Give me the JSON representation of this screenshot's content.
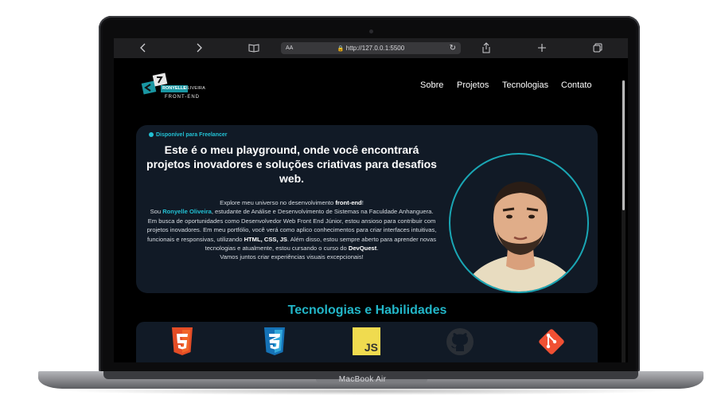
{
  "device": {
    "label": "MacBook Air"
  },
  "browser": {
    "url": "http://127.0.0.1:5500",
    "reader_label": "AA",
    "back_icon": "chevron-left-icon",
    "forward_icon": "chevron-right-icon",
    "bookmarks_icon": "book-icon",
    "share_icon": "share-icon",
    "new_tab_icon": "plus-icon",
    "tabs_icon": "tabs-icon"
  },
  "header": {
    "logo": {
      "first_name": "RONYELLE",
      "last_name": "OLIVEIRA",
      "subtitle": "FRONT-END"
    },
    "nav": [
      "Sobre",
      "Projetos",
      "Tecnologias",
      "Contato"
    ]
  },
  "hero": {
    "badge": "Disponível para Freelancer",
    "headline": "Este é o meu playground, onde você encontrará projetos inovadores e soluções criativas para desafios web.",
    "paragraph": {
      "p1": "Explore meu universo no desenvolvimento ",
      "p1_bold": "front-end",
      "p1_end": "!",
      "p2": "Sou ",
      "name": "Ronyelle Oliveira",
      "p3": ", estudante de Análise e Desenvolvimento de Sistemas na Faculdade Anhanguera. Em busca de oportunidades como Desenvolvedor Web Front End Júnior, estou ansioso para contribuir com projetos inovadores. Em meu portfólio, você verá como aplico conhecimentos para criar interfaces intuitivas, funcionais e responsivas, utilizando ",
      "tech_bold": "HTML, CSS, JS",
      "p4": ". Além disso, estou sempre aberto para aprender novas tecnologias e atualmente, estou cursando o curso do ",
      "course_bold": "DevQuest",
      "p5": ".",
      "p6": "Vamos juntos criar experiências visuais excepcionais!"
    }
  },
  "skills": {
    "title": "Tecnologias e Habilidades",
    "items": [
      "html5-icon",
      "css3-icon",
      "javascript-icon",
      "github-icon",
      "git-icon"
    ],
    "js_label": "JS"
  },
  "colors": {
    "accent": "#22c1d4",
    "card": "#111a26",
    "html": "#e44d26",
    "css": "#1572b6",
    "js": "#f0db4f",
    "git": "#f05033"
  }
}
